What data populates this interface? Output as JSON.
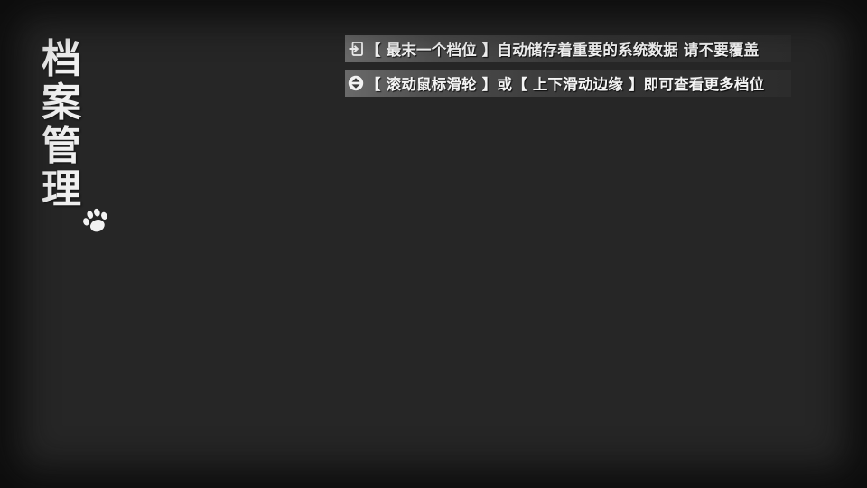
{
  "screen": {
    "title_chars": [
      "档",
      "案",
      "管",
      "理"
    ],
    "paw_icon": "paw-print-icon"
  },
  "hints": [
    {
      "icon": "enter-arrow-icon",
      "text": "【 最末一个档位 】自动储存着重要的系统数据   请不要覆盖"
    },
    {
      "icon": "scroll-updown-icon",
      "text": "【 滚动鼠标滑轮 】或【 上下滑动边缘 】即可查看更多档位"
    }
  ],
  "colors": {
    "background": "#262626",
    "text": "#f4f4f4"
  }
}
